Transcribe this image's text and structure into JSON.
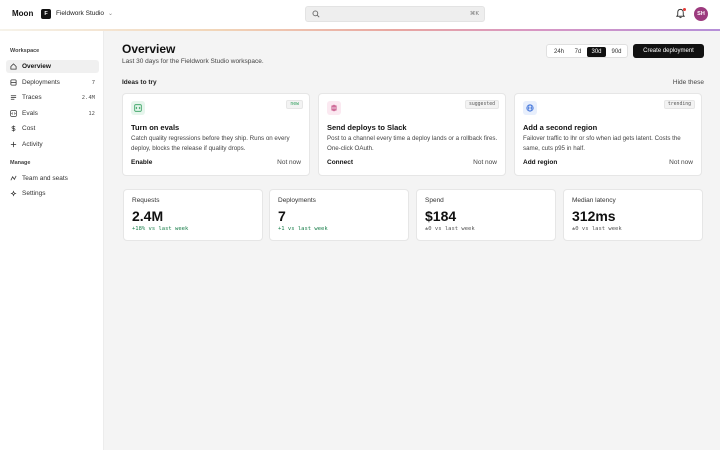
{
  "app": {
    "brand": "Moon",
    "workspace_initial": "F",
    "workspace_name": "Fieldwork Studio",
    "search_shortcut": "⌘K",
    "avatar_initials": "SH",
    "icons": {
      "search": "search-icon",
      "notifications": "bell-icon",
      "workspace_switch": "chevron-down-icon"
    },
    "colors": {
      "accent_gradient": [
        "#f6f3ea",
        "#f1d5b8",
        "#e8a6a0",
        "#d796c4",
        "#b58fd8"
      ],
      "avatar": "#9c3a7e",
      "notification_dot": "#e53935"
    }
  },
  "sidebar": {
    "sections": [
      {
        "label": "Workspace",
        "items": [
          {
            "label": "Overview",
            "icon": "home-icon",
            "count": "",
            "active": true
          },
          {
            "label": "Deployments",
            "icon": "deploy-icon",
            "count": "7"
          },
          {
            "label": "Traces",
            "icon": "list-icon",
            "count": "2.4M"
          },
          {
            "label": "Evals",
            "icon": "code-icon",
            "count": "12"
          },
          {
            "label": "Cost",
            "icon": "dollar-icon",
            "count": ""
          },
          {
            "label": "Activity",
            "icon": "activity-icon",
            "count": ""
          }
        ]
      },
      {
        "label": "Manage",
        "items": [
          {
            "label": "Team and seats",
            "icon": "team-icon",
            "count": ""
          },
          {
            "label": "Settings",
            "icon": "gear-icon",
            "count": ""
          }
        ]
      }
    ]
  },
  "header": {
    "title": "Overview",
    "subtitle": "Last 30 days for the Fieldwork Studio workspace.",
    "ranges": [
      "24h",
      "7d",
      "30d",
      "90d"
    ],
    "active_range": "30d",
    "create_label": "Create deployment"
  },
  "ideas": {
    "title": "Ideas to try",
    "hide_label": "Hide these",
    "cards": [
      {
        "icon": "code-icon",
        "icon_color": "#2e9e5b",
        "icon_bg": "#e6f5ec",
        "tag": "new",
        "tag_color": "#2e9e5b",
        "title": "Turn on evals",
        "description": "Catch quality regressions before they ship. Runs on every deploy, blocks the release if quality drops.",
        "action": "Enable",
        "dismiss": "Not now"
      },
      {
        "icon": "slack-icon",
        "icon_color": "#c0407a",
        "icon_bg": "#fbe9f1",
        "tag": "suggested",
        "tag_color": "#555555",
        "title": "Send deploys to Slack",
        "description": "Post to a channel every time a deploy lands or a rollback fires. One-click OAuth.",
        "action": "Connect",
        "dismiss": "Not now"
      },
      {
        "icon": "globe-icon",
        "icon_color": "#3a6fd8",
        "icon_bg": "#e8effc",
        "tag": "trending",
        "tag_color": "#555555",
        "title": "Add a second region",
        "description": "Failover traffic to lhr or sfo when iad gets latent. Costs the same, cuts p95 in half.",
        "action": "Add region",
        "dismiss": "Not now"
      }
    ]
  },
  "stats": [
    {
      "label": "Requests",
      "value": "2.4M",
      "delta": "+18% vs last week",
      "trend": "up"
    },
    {
      "label": "Deployments",
      "value": "7",
      "delta": "+1 vs last week",
      "trend": "up"
    },
    {
      "label": "Spend",
      "value": "$184",
      "delta": "±0 vs last week",
      "trend": "flat"
    },
    {
      "label": "Median latency",
      "value": "312ms",
      "delta": "±0 vs last week",
      "trend": "flat"
    }
  ]
}
